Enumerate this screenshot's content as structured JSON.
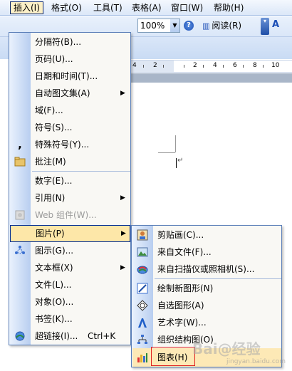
{
  "menubar": {
    "items": [
      {
        "label": "插入(I)",
        "active": true
      },
      {
        "label": "格式(O)"
      },
      {
        "label": "工具(T)"
      },
      {
        "label": "表格(A)"
      },
      {
        "label": "窗口(W)"
      },
      {
        "label": "帮助(H)"
      }
    ]
  },
  "toolbar": {
    "zoom_value": "100%",
    "read_label": "阅读(R)",
    "font_size_glyph": "A"
  },
  "ruler": {
    "numbers": [
      "4",
      "2",
      "2",
      "4",
      "6",
      "8",
      "10"
    ]
  },
  "insert_menu": {
    "items": [
      {
        "label": "分隔符(B)...",
        "icon": "none"
      },
      {
        "label": "页码(U)...",
        "icon": "none"
      },
      {
        "label": "日期和时间(T)...",
        "icon": "none"
      },
      {
        "label": "自动图文集(A)",
        "submenu": true,
        "icon": "none"
      },
      {
        "label": "域(F)...",
        "icon": "none"
      },
      {
        "label": "符号(S)...",
        "icon": "none"
      },
      {
        "label": "特殊符号(Y)...",
        "icon": "comma-icon"
      },
      {
        "label": "批注(M)",
        "icon": "comment-folder-icon"
      },
      {
        "label": "数字(E)...",
        "icon": "none"
      },
      {
        "label": "引用(N)",
        "submenu": true,
        "icon": "none"
      },
      {
        "label": "Web 组件(W)...",
        "disabled": true,
        "icon": "web-component-icon"
      },
      {
        "label": "图片(P)",
        "submenu": true,
        "highlighted": true,
        "icon": "none"
      },
      {
        "label": "图示(G)...",
        "icon": "diagram-icon"
      },
      {
        "label": "文本框(X)",
        "submenu": true,
        "icon": "none"
      },
      {
        "label": "文件(L)...",
        "icon": "none"
      },
      {
        "label": "对象(O)...",
        "icon": "none"
      },
      {
        "label": "书签(K)...",
        "icon": "none"
      },
      {
        "label": "超链接(I)...",
        "shortcut": "Ctrl+K",
        "icon": "hyperlink-icon"
      }
    ]
  },
  "picture_submenu": {
    "items": [
      {
        "label": "剪贴画(C)...",
        "icon": "clipart-icon"
      },
      {
        "label": "来自文件(F)...",
        "icon": "picture-from-file-icon"
      },
      {
        "label": "来自扫描仪或照相机(S)...",
        "icon": "scanner-camera-icon"
      },
      {
        "label": "绘制新图形(N)",
        "icon": "new-drawing-icon"
      },
      {
        "label": "自选图形(A)",
        "icon": "autoshape-icon"
      },
      {
        "label": "艺术字(W)...",
        "icon": "wordart-icon"
      },
      {
        "label": "组织结构图(O)",
        "icon": "org-chart-icon"
      },
      {
        "label": "图表(H)",
        "icon": "chart-icon",
        "highlighted": true
      }
    ]
  },
  "watermark": {
    "text": "Bai@经验",
    "sub": "jingyan.baidu.com"
  },
  "colors": {
    "menu_highlight": "#fde7a8",
    "menu_border": "#002d96",
    "red_annotation": "#e02020"
  }
}
